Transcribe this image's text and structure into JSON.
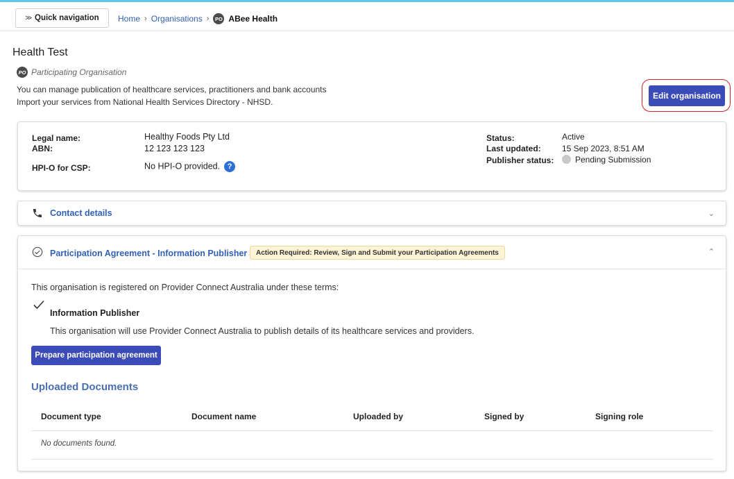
{
  "nav": {
    "quick_navigation": "Quick navigation",
    "quick_nav_chevrons": ">>",
    "breadcrumb": {
      "home": "Home",
      "organisations": "Organisations",
      "badge": "PO",
      "current": "ABee Health"
    }
  },
  "header": {
    "title": "Health Test",
    "badge": "PO",
    "org_type": "Participating Organisation",
    "description_line1": "You can manage publication of healthcare services, practitioners and bank accounts",
    "description_line2": "Import your services from National Health Services Directory - NHSD.",
    "edit_button": "Edit organisation"
  },
  "details": {
    "legal_name_label": "Legal name:",
    "legal_name_value": "Healthy Foods Pty Ltd",
    "abn_label": "ABN:",
    "abn_value": "12 123 123 123",
    "hpio_label": "HPI-O for CSP:",
    "hpio_value": "No HPI-O provided.",
    "help_icon": "?",
    "status_label": "Status:",
    "status_value": "Active",
    "last_updated_label": "Last updated:",
    "last_updated_value": "15 Sep 2023, 8:51 AM",
    "publisher_status_label": "Publisher status:",
    "publisher_status_value": "Pending Submission"
  },
  "contact": {
    "title": "Contact details"
  },
  "participation": {
    "title": "Participation Agreement - Information Publisher",
    "badge": "Action Required: Review, Sign and Submit your Participation Agreements",
    "intro": "This organisation is registered on Provider Connect Australia under these terms:",
    "term_title": "Information Publisher",
    "term_description": "This organisation will use Provider Connect Australia to publish details of its healthcare services and providers.",
    "prepare_button": "Prepare participation agreement",
    "documents_title": "Uploaded Documents",
    "columns": [
      "Document type",
      "Document name",
      "Uploaded by",
      "Signed by",
      "Signing role"
    ],
    "empty_message": "No documents found."
  },
  "colors": {
    "primary_button": "#3b4bb8",
    "link": "#3160b6",
    "highlight_ring": "#d2202a",
    "top_accent": "#5fc7ee"
  }
}
